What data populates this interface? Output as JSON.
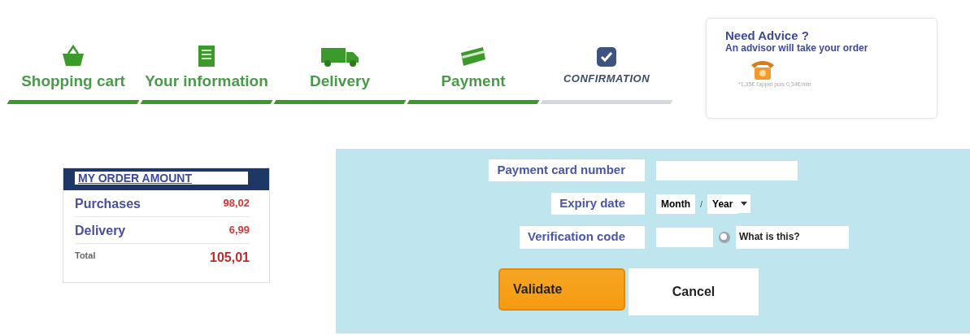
{
  "steps": [
    {
      "label": "Shopping cart",
      "kind": "basket",
      "done": true
    },
    {
      "label": "Your information",
      "kind": "document",
      "done": true
    },
    {
      "label": "Delivery",
      "kind": "truck",
      "done": true
    },
    {
      "label": "Payment",
      "kind": "card",
      "done": true
    },
    {
      "label": "CONFIRMATION",
      "kind": "check",
      "done": false
    }
  ],
  "advice": {
    "title": "Need Advice ?",
    "subtitle": "An advisor will take your order",
    "note": "*1,35€ l'appel puis 0,34€/min"
  },
  "order": {
    "title": "MY ORDER AMOUNT",
    "rows": [
      {
        "label": "Purchases",
        "value": "98,02",
        "kind": "line"
      },
      {
        "label": "Delivery",
        "value": "6,99",
        "kind": "line"
      },
      {
        "label": "Total",
        "value": "105,01",
        "kind": "total"
      }
    ]
  },
  "form": {
    "card_label": "Payment card number",
    "expiry_label": "Expiry date",
    "month": "Month",
    "separator": "/",
    "year": "Year",
    "code_label": "Verification code",
    "help": "What is this?",
    "validate": "Validate",
    "cancel": "Cancel"
  }
}
